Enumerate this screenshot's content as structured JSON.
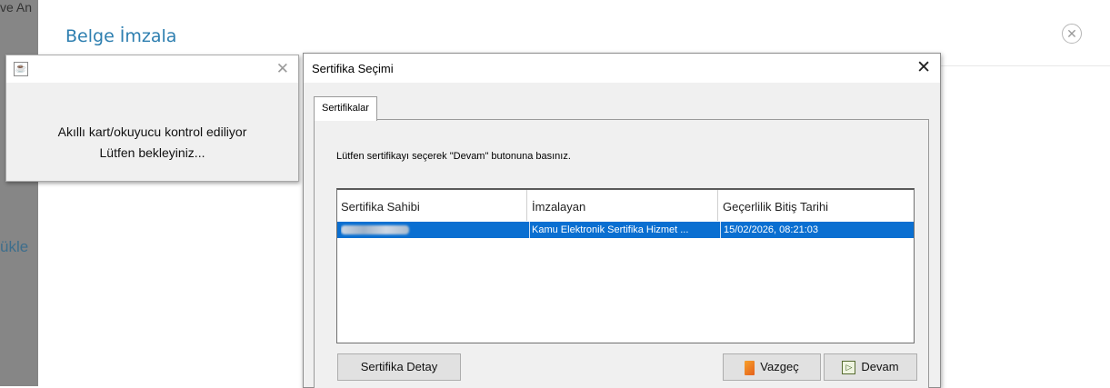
{
  "background": {
    "left_cut_text_top": "ve An",
    "left_cut_text_mid": "ükle",
    "modal_title": "Belge İmzala",
    "modal_close_symbol": "✕"
  },
  "wait_dialog": {
    "close_symbol": "✕",
    "line1": "Akıllı kart/okuyucu kontrol ediliyor",
    "line2": "Lütfen bekleyiniz..."
  },
  "cert_dialog": {
    "title": "Sertifika Seçimi",
    "close_symbol": "✕",
    "tab_label": "Sertifikalar",
    "instruction": "Lütfen sertifikayı seçerek \"Devam\" butonuna basınız.",
    "columns": [
      "Sertifika Sahibi",
      "İmzalayan",
      "Geçerlilik Bitiş Tarihi"
    ],
    "rows": [
      {
        "owner": "",
        "issuer": "Kamu Elektronik Sertifika Hizmet ...",
        "expiry": "15/02/2026, 08:21:03"
      }
    ],
    "buttons": {
      "detail": "Sertifika Detay",
      "cancel": "Vazgeç",
      "continue": "Devam"
    }
  },
  "colors": {
    "selection": "#0a6fd1",
    "modal_title": "#2e7fb0"
  }
}
